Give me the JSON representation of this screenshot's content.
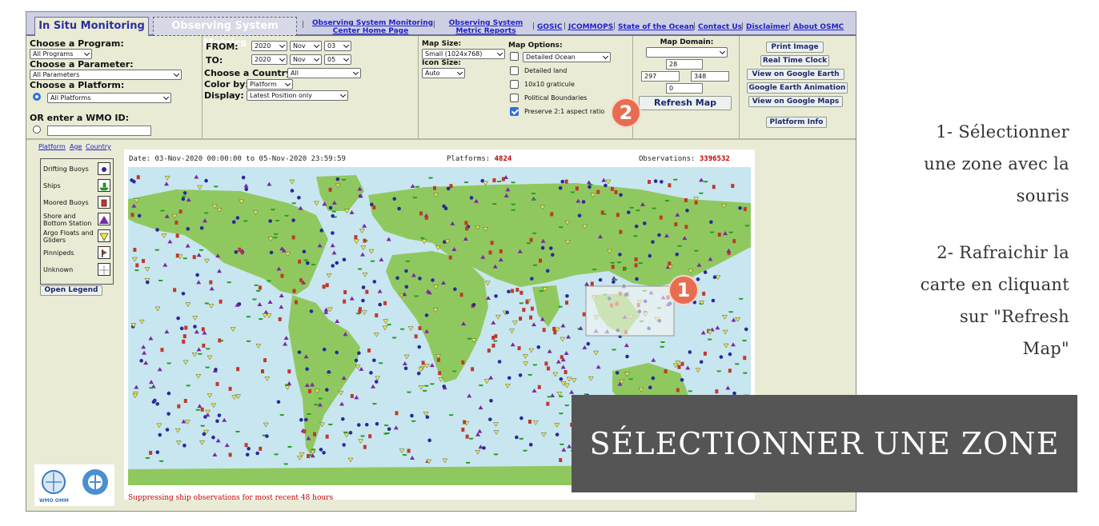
{
  "tabs": {
    "active": "In Situ Monitoring",
    "inactive": "Observing System Metrics"
  },
  "header_links": {
    "home_line1": "Observing System Monitoring",
    "home_line2": "Center Home Page",
    "metric_line1": "Observing System",
    "metric_line2": "Metric Reports",
    "gosic": "GOSIC",
    "jcommops": "JCOMMOPS",
    "state_ocean": "State of the Ocean",
    "contact": "Contact Us",
    "disclaimer": "Disclaimer",
    "about": "About OSMC"
  },
  "controls": {
    "program_label": "Choose a Program:",
    "program_value": "All Programs",
    "parameter_label": "Choose a Parameter:",
    "parameter_value": "All Parameters",
    "platform_label": "Choose a Platform:",
    "platform_value": "All Platforms",
    "wmo_label": "OR enter a WMO ID:",
    "from_label": "FROM:",
    "to_label": "TO:",
    "from_year": "2020",
    "from_month": "Nov",
    "from_day": "03",
    "to_year": "2020",
    "to_month": "Nov",
    "to_day": "05",
    "country_label": "Choose a Country:",
    "country_value": "All",
    "color_label": "Color by:",
    "color_value": "Platform",
    "display_label": "Display:",
    "display_value": "Latest Position only",
    "map_size_label": "Map Size:",
    "map_size_value": "Small (1024x768)",
    "icon_size_label": "Icon Size:",
    "icon_size_value": "Auto",
    "map_options_label": "Map Options:",
    "ocean_value": "Detailed Ocean",
    "options": [
      {
        "label": "Detailed land",
        "checked": false
      },
      {
        "label": "10x10 graticule",
        "checked": false
      },
      {
        "label": "Political Boundaries",
        "checked": false
      },
      {
        "label": "Preserve 2:1 aspect ratio",
        "checked": true
      }
    ],
    "map_domain_label": "Map Domain:",
    "domain_north": "28",
    "domain_west": "297",
    "domain_east": "348",
    "domain_south": "0",
    "refresh_label": "Refresh Map"
  },
  "side_buttons": {
    "print": "Print Image",
    "clock": "Real Time Clock",
    "google_earth": "View on Google Earth",
    "google_earth_anim": "Google Earth Animation",
    "google_maps": "View on Google Maps",
    "platform_info": "Platform Info"
  },
  "map_links": {
    "platform": "Platform",
    "age": "Age",
    "country": "Country"
  },
  "legend": {
    "items": [
      {
        "label": "Drifting Buoys",
        "icon": "drifting-buoy-icon",
        "color": "#2a2a9a"
      },
      {
        "label": "Ships",
        "icon": "ship-icon",
        "color": "#22a022"
      },
      {
        "label": "Moored Buoys",
        "icon": "moored-buoy-icon",
        "color": "#c0392b"
      },
      {
        "label": "Shore and Bottom Station",
        "icon": "shore-station-icon",
        "color": "#7a2aa0"
      },
      {
        "label": "Argo Floats and Gliders",
        "icon": "argo-float-icon",
        "color": "#e8e84a"
      },
      {
        "label": "Pinnipeds",
        "icon": "pinniped-icon",
        "color": "#a0502a"
      },
      {
        "label": "Unknown",
        "icon": "unknown-icon",
        "color": "#999999"
      }
    ],
    "open_button": "Open Legend"
  },
  "map": {
    "date_text": "Date: 03-Nov-2020 00:00:00 to 05-Nov-2020 23:59:59",
    "platforms_label": "Platforms:",
    "platforms_value": "4824",
    "observations_label": "Observations:",
    "observations_value": "3396532",
    "suppress_note": "Suppressing ship observations for most recent 48 hours",
    "ocean_color": "#c8e6f0",
    "land_color": "#90c860"
  },
  "logos": {
    "wmo": "WMO OMM"
  },
  "instructions": {
    "step1": [
      "1- Sélectionner",
      "une zone avec la",
      "souris"
    ],
    "step2": [
      "2- Rafraichir la",
      "carte en cliquant",
      "sur \"Refresh",
      "Map\""
    ]
  },
  "badges": {
    "one": "1",
    "two": "2"
  },
  "banner_title": "SÉLECTIONNER UNE ZONE"
}
